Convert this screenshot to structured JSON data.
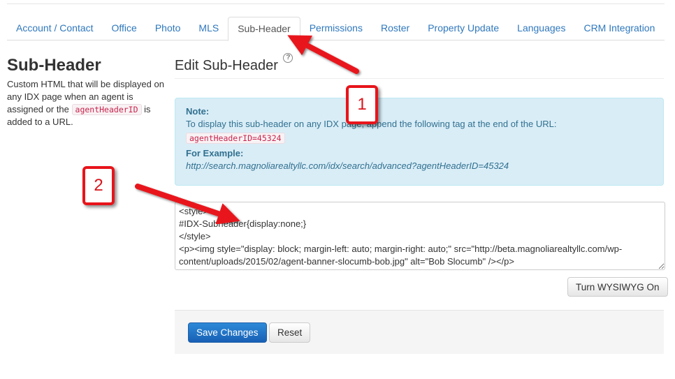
{
  "tabs": [
    {
      "label": "Account / Contact"
    },
    {
      "label": "Office"
    },
    {
      "label": "Photo"
    },
    {
      "label": "MLS"
    },
    {
      "label": "Sub-Header"
    },
    {
      "label": "Permissions"
    },
    {
      "label": "Roster"
    },
    {
      "label": "Property Update"
    },
    {
      "label": "Languages"
    },
    {
      "label": "CRM Integration"
    }
  ],
  "active_tab": "Sub-Header",
  "sidebar": {
    "title": "Sub-Header",
    "desc_before": "Custom HTML that will be displayed on any IDX page when an agent is assigned or the ",
    "desc_code": "agentHeaderID",
    "desc_after": " is added to a URL."
  },
  "main": {
    "title": "Edit Sub-Header",
    "help_icon": "help-circle-icon",
    "note": {
      "label": "Note:",
      "text": "To display this sub-header on any IDX page, append the following tag at the end of the URL:",
      "tag": "agentHeaderID=45324",
      "example_label": "For Example:",
      "example_url": "http://search.magnoliarealtyllc.com/idx/search/advanced?agentHeaderID=45324"
    },
    "editor_value": "<style>\n#IDX-Subheader{display:none;}\n</style>\n<p><img style=\"display: block; margin-left: auto; margin-right: auto;\" src=\"http://beta.magnoliarealtyllc.com/wp-content/uploads/2015/02/agent-banner-slocumb-bob.jpg\" alt=\"Bob Slocumb\" /></p>",
    "wysiwyg_button": "Turn WYSIWYG On",
    "save_button": "Save Changes",
    "reset_button": "Reset"
  },
  "annotations": [
    {
      "number": "1"
    },
    {
      "number": "2"
    }
  ],
  "colors": {
    "link": "#2f78bd",
    "note_bg": "#d9edf7",
    "primary": "#1f6fc6",
    "annotation_red": "#e8141b"
  }
}
